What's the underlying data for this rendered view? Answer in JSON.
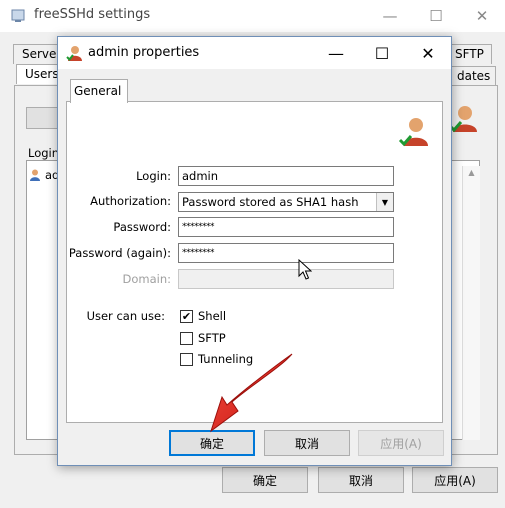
{
  "background_window": {
    "title": "freeSSHd settings",
    "tabs": [
      "Server",
      "Users",
      "SFTP",
      "dates"
    ],
    "list_header": "Login",
    "list_item": "ad",
    "buttons": {
      "ok": "确定",
      "cancel": "取消",
      "apply": "应用(A)"
    },
    "controls": {
      "minimize": "—",
      "maximize": "☐",
      "close": "✕"
    }
  },
  "dialog": {
    "title": "admin properties",
    "tab": "General",
    "fields": {
      "login_label": "Login:",
      "login_value": "admin",
      "authorization_label": "Authorization:",
      "authorization_value": "Password stored as SHA1 hash",
      "password_label": "Password:",
      "password_value": "********",
      "password_again_label": "Password (again):",
      "password_again_value": "********",
      "domain_label": "Domain:"
    },
    "user_can_use": {
      "label": "User can use:",
      "shell": "Shell",
      "sftp": "SFTP",
      "tunneling": "Tunneling",
      "shell_checked": true,
      "sftp_checked": false,
      "tunneling_checked": false
    },
    "buttons": {
      "ok": "确定",
      "cancel": "取消",
      "apply": "应用(A)"
    },
    "controls": {
      "minimize": "—",
      "maximize": "☐",
      "close": "✕"
    }
  },
  "colors": {
    "accent": "#0078d7",
    "annotation_arrow": "#e8231f"
  }
}
